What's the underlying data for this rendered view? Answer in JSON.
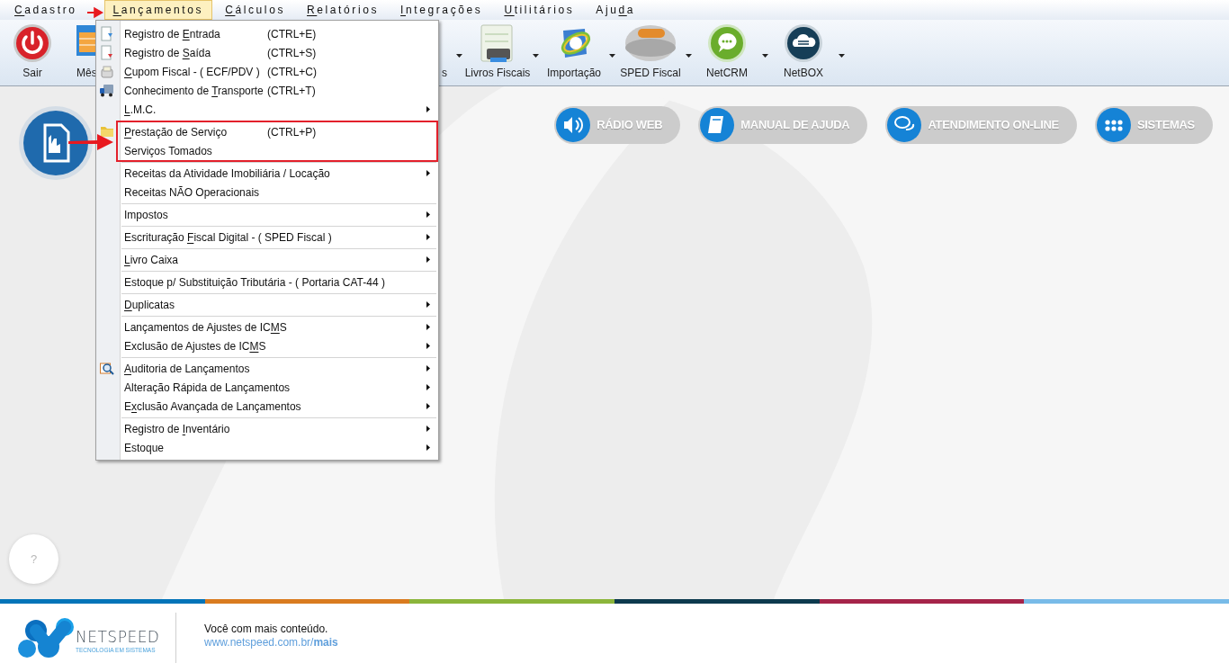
{
  "menubar": [
    {
      "parts": [
        {
          "text": "C",
          "underline": true
        },
        {
          "text": "adastro",
          "underline": false
        }
      ],
      "selected": false
    },
    {
      "parts": [
        {
          "text": "L",
          "underline": true
        },
        {
          "text": "ançamentos",
          "underline": false
        }
      ],
      "selected": true
    },
    {
      "parts": [
        {
          "text": "C",
          "underline": true
        },
        {
          "text": "álculos",
          "underline": false
        }
      ],
      "selected": false
    },
    {
      "parts": [
        {
          "text": "R",
          "underline": true
        },
        {
          "text": "elatórios",
          "underline": false
        }
      ],
      "selected": false
    },
    {
      "parts": [
        {
          "text": "I",
          "underline": true
        },
        {
          "text": "ntegrações",
          "underline": false
        }
      ],
      "selected": false
    },
    {
      "parts": [
        {
          "text": "U",
          "underline": true
        },
        {
          "text": "tilitários",
          "underline": false
        }
      ],
      "selected": false
    },
    {
      "parts": [
        {
          "text": "Aju",
          "underline": false
        },
        {
          "text": "d",
          "underline": true
        },
        {
          "text": "a",
          "underline": false
        }
      ],
      "selected": false
    }
  ],
  "toolbar": [
    {
      "kind": "power",
      "label": "Sair",
      "dropdown": false
    },
    {
      "kind": "calendar",
      "label": "Mês",
      "dropdown": false
    },
    {
      "kind": "covered",
      "label": "s",
      "dropdown": true
    },
    {
      "kind": "printer",
      "label": "Livros Fiscais",
      "dropdown": true
    },
    {
      "kind": "globe-document",
      "label": "Importação",
      "dropdown": true
    },
    {
      "kind": "sphere",
      "label": "SPED Fiscal",
      "dropdown": true
    },
    {
      "kind": "chat",
      "label": "NetCRM",
      "dropdown": true
    },
    {
      "kind": "cloud",
      "label": "NetBOX",
      "dropdown": true
    }
  ],
  "menu": {
    "groups": [
      {
        "highlighted": false,
        "items": [
          {
            "kind": "doc-in",
            "parts": [
              {
                "text": "Registro de ",
                "underline": false
              },
              {
                "text": "E",
                "underline": true
              },
              {
                "text": "ntrada",
                "underline": false
              }
            ],
            "shortcut": "(CTRL+E)",
            "submenu": false
          },
          {
            "kind": "doc-out",
            "parts": [
              {
                "text": "Registro de ",
                "underline": false
              },
              {
                "text": "S",
                "underline": true
              },
              {
                "text": "aída",
                "underline": false
              }
            ],
            "shortcut": "(CTRL+S)",
            "submenu": false
          },
          {
            "kind": "printer",
            "parts": [
              {
                "text": "C",
                "underline": true
              },
              {
                "text": "upom Fiscal - ( ECF/PDV )",
                "underline": false
              }
            ],
            "shortcut": "(CTRL+C)",
            "submenu": false
          },
          {
            "kind": "truck",
            "parts": [
              {
                "text": "Conhecimento de ",
                "underline": false
              },
              {
                "text": "T",
                "underline": true
              },
              {
                "text": "ransporte",
                "underline": false
              }
            ],
            "shortcut": "(CTRL+T)",
            "submenu": false
          },
          {
            "kind": "plain",
            "parts": [
              {
                "text": "L",
                "underline": true
              },
              {
                "text": ".M.C.",
                "underline": false
              }
            ],
            "submenu": true
          }
        ]
      },
      {
        "highlighted": true,
        "items": [
          {
            "kind": "folder",
            "parts": [
              {
                "text": "P",
                "underline": true
              },
              {
                "text": "restação de Serviço",
                "underline": false
              }
            ],
            "shortcut": "(CTRL+P)",
            "submenu": false
          },
          {
            "kind": "plain",
            "parts": [
              {
                "text": "Serviços Tomados",
                "underline": false
              }
            ],
            "submenu": false
          }
        ]
      },
      {
        "highlighted": false,
        "items": [
          {
            "kind": "plain",
            "parts": [
              {
                "text": "Receitas da Atividade Imobiliária / Locação",
                "underline": false
              }
            ],
            "submenu": true
          },
          {
            "kind": "plain",
            "parts": [
              {
                "text": "Receitas NÃO Operacionais",
                "underline": false
              }
            ],
            "submenu": false
          }
        ]
      },
      {
        "highlighted": false,
        "items": [
          {
            "kind": "plain",
            "parts": [
              {
                "text": "Impostos",
                "underline": false
              }
            ],
            "submenu": true
          }
        ]
      },
      {
        "highlighted": false,
        "items": [
          {
            "kind": "plain",
            "parts": [
              {
                "text": "Escrituração ",
                "underline": false
              },
              {
                "text": "F",
                "underline": true
              },
              {
                "text": "iscal Digital - ( SPED Fiscal )",
                "underline": false
              }
            ],
            "submenu": true
          }
        ]
      },
      {
        "highlighted": false,
        "items": [
          {
            "kind": "plain",
            "parts": [
              {
                "text": "L",
                "underline": true
              },
              {
                "text": "ivro Caixa",
                "underline": false
              }
            ],
            "submenu": true
          }
        ]
      },
      {
        "highlighted": false,
        "items": [
          {
            "kind": "plain",
            "parts": [
              {
                "text": "Estoque p/ Substituição Tributária - ( Portaria CAT-44 )",
                "underline": false
              }
            ],
            "submenu": false
          }
        ]
      },
      {
        "highlighted": false,
        "items": [
          {
            "kind": "plain",
            "parts": [
              {
                "text": "D",
                "underline": true
              },
              {
                "text": "uplicatas",
                "underline": false
              }
            ],
            "submenu": true
          }
        ]
      },
      {
        "highlighted": false,
        "items": [
          {
            "kind": "plain",
            "parts": [
              {
                "text": "Lançamentos de Ajustes de IC",
                "underline": false
              },
              {
                "text": "M",
                "underline": true
              },
              {
                "text": "S",
                "underline": false
              }
            ],
            "submenu": true
          },
          {
            "kind": "plain",
            "parts": [
              {
                "text": "Exclusão de Ajustes de IC",
                "underline": false
              },
              {
                "text": "M",
                "underline": true
              },
              {
                "text": "S",
                "underline": false
              }
            ],
            "submenu": true
          }
        ]
      },
      {
        "highlighted": false,
        "items": [
          {
            "kind": "magnifier",
            "parts": [
              {
                "text": "A",
                "underline": true
              },
              {
                "text": "uditoria de Lançamentos",
                "underline": false
              }
            ],
            "submenu": true
          },
          {
            "kind": "plain",
            "parts": [
              {
                "text": "Alteração Rápida de Lançamentos",
                "underline": false
              }
            ],
            "submenu": true
          },
          {
            "kind": "plain",
            "parts": [
              {
                "text": "E",
                "underline": false
              },
              {
                "text": "x",
                "underline": true
              },
              {
                "text": "clusão Avançada de Lançamentos",
                "underline": false
              }
            ],
            "submenu": true
          }
        ]
      },
      {
        "highlighted": false,
        "items": [
          {
            "kind": "plain",
            "parts": [
              {
                "text": "Registro de ",
                "underline": false
              },
              {
                "text": "I",
                "underline": true
              },
              {
                "text": "nventário",
                "underline": false
              }
            ],
            "submenu": true
          },
          {
            "kind": "plain",
            "parts": [
              {
                "text": "Estoque",
                "underline": false
              }
            ],
            "submenu": true
          }
        ]
      }
    ]
  },
  "quick_buttons": [
    {
      "kind": "speaker",
      "label": "RÁDIO WEB"
    },
    {
      "kind": "book",
      "label": "MANUAL DE AJUDA"
    },
    {
      "kind": "chat",
      "label": "ATENDIMENTO ON-LINE"
    },
    {
      "kind": "grid",
      "label": "SISTEMAS"
    }
  ],
  "help_button": {
    "label": "?"
  },
  "footer": {
    "stripe": [
      {
        "color": "#0474b8"
      },
      {
        "color": "#d97b1f"
      },
      {
        "color": "#8bb53b"
      },
      {
        "color": "#0d3a4e"
      },
      {
        "color": "#a52449"
      },
      {
        "color": "#78bbe8"
      }
    ],
    "brand": "NETSPEED",
    "tagline": "TECNOLOGIA EM SISTEMAS",
    "slogan": "Você com mais conteúdo.",
    "link": "www.netspeed.com.br/**mais**"
  }
}
